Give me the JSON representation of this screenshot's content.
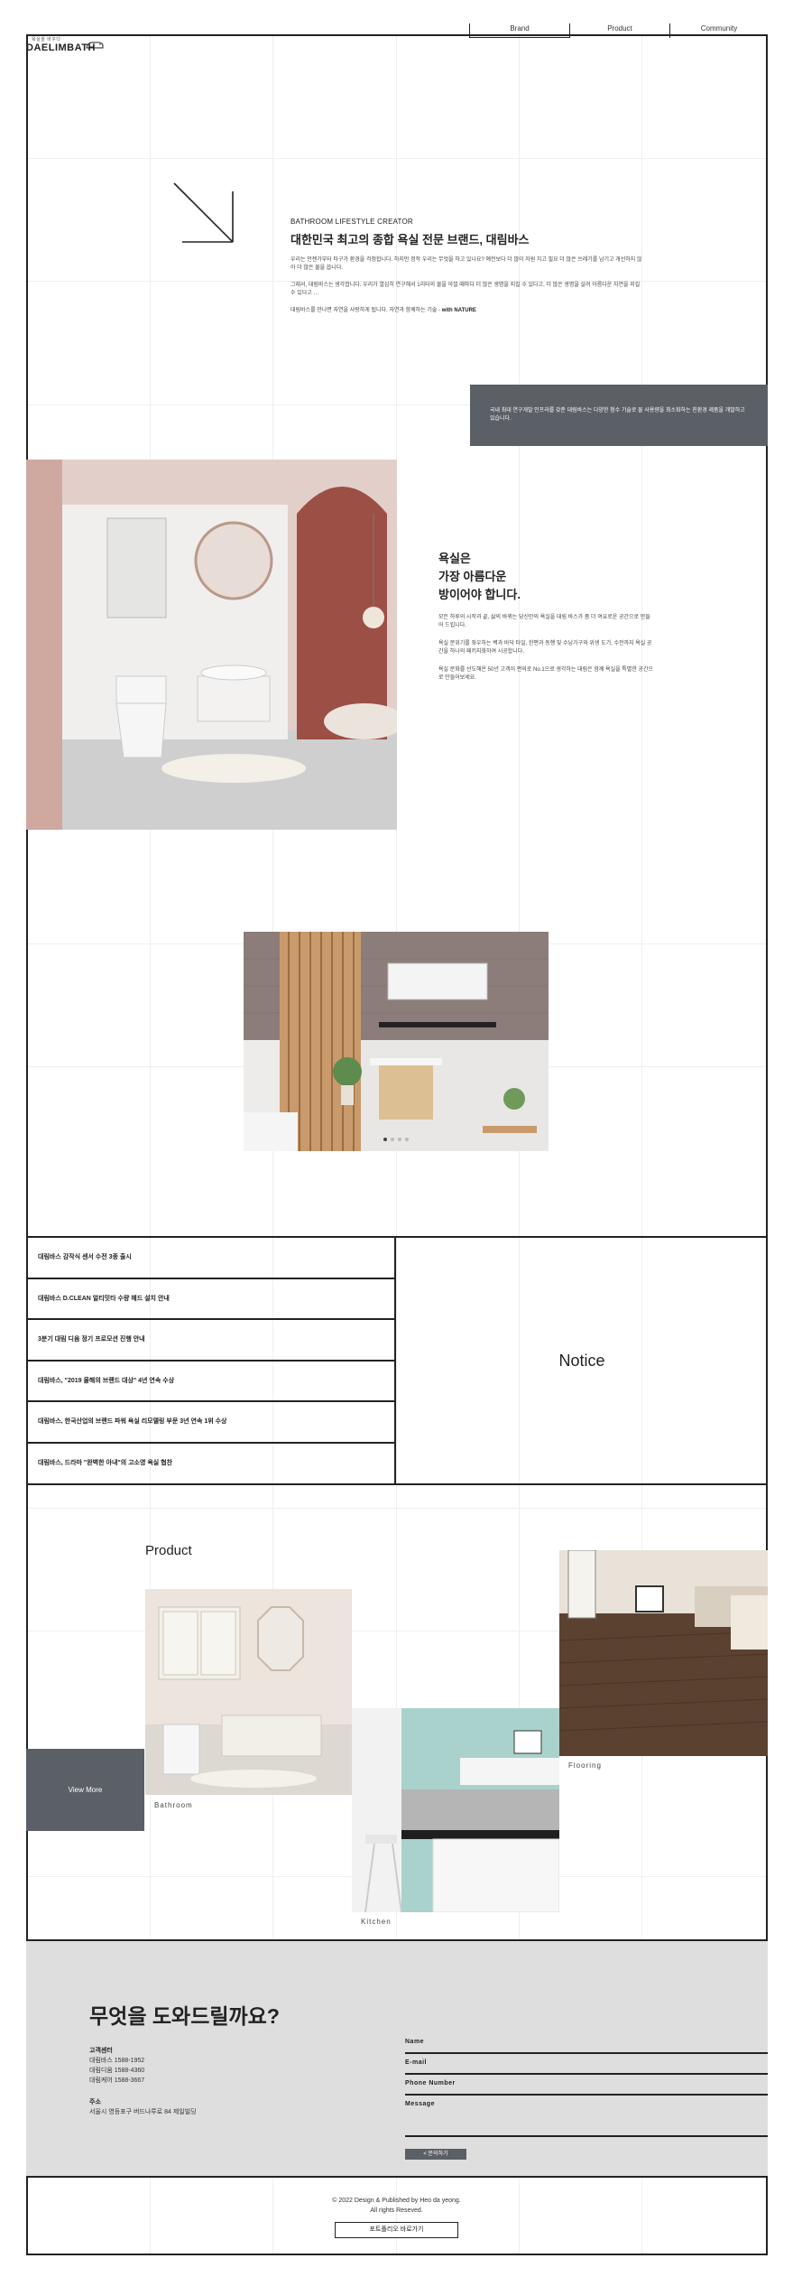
{
  "header": {
    "logo_small": "욕실을 바꾸다",
    "logo_big": "DAELIMBATH",
    "nav": [
      "Brand",
      "Product",
      "Community"
    ]
  },
  "intro": {
    "eyebrow": "BATHROOM LIFESTYLE CREATOR",
    "title": "대한민국 최고의 종합 욕실 전문 브랜드, 대림바스",
    "p1": "우리는 언젠가부터 타구가 환경을 걱정합니다. 하지만 정작 우리는 무엇을 하고 있나요? 예전보다 더 많이 자원 치고 필요 더 많은 쓰레기를 남기고 개선하지 않아 더 많은 물을 씁니다.",
    "p2": "그래서, 대림바스는 생각합니다. 우리가 열심히 연구해서 1리터의 물을 아낄 때마다 더 많은 생명을 지킬 수 있다고, 더 많은 생명을 살려 아름다운 자연을 지킬 수 있다고 …",
    "p3_text": "대림바스를 만나면 자연을 사랑하게 됩니다. 자연과 함께하는 기술 - ",
    "p3_bold": "with NATURE"
  },
  "gray_box": "국내 최대 연구개발 인프라를 갖춘 대림바스는 다양한 첨수 기술로 물 사용량을 최소화하는 친환경 제품을 개발하고 있습니다.",
  "quote": {
    "line1": "욕실은",
    "line2": "가장 아름다운",
    "line3": "방이어야 합니다.",
    "p1": "모든 하루의 시작과 끝, 삶의 바뀌는 당신만의 욕실을 대림 바스가 좀 더 여유로운 공간으로 만들어 드립니다.",
    "p2": "욕실 분위기를 좌우하는 벽과 바닥 타일, 한편과 동행 및 수납가구와 위생 도기, 수전까지 욕실 공간을 하나의 패키지화하여 시공합니다.",
    "p3": "욕실 문화를 선도해온 50년 고객이 편의로 No.1으로 생각하는 대림은 함께 욕실을 특별한 공간으로 만들어보세요."
  },
  "notices": [
    "대림바스 감작식 센서 수전 3종 출시",
    "대림바스 D.CLEAN 얼티밋타 수량 헤드 설치 안내",
    "3분기 대림 디움 정기 프로모션 진행 안내",
    "대림바스, \"2019 올해의 브랜드 대상\" 4년 연속 수상",
    "대림바스, 한국산업의 브랜드 파워 욕실 리모델링 부문 3년 연속 1위 수상",
    "대림바스, 드라마 \"완벽한 아내\"의 고소영 욕실 협찬"
  ],
  "notice_title": "Notice",
  "product": {
    "title": "Product",
    "view_more": "View More",
    "bathroom": "Bathroom",
    "kitchen": "Kitchen",
    "flooring": "Flooring"
  },
  "contact": {
    "heading": "무엇을 도와드릴까요?",
    "center_label": "고객센터",
    "center_lines": [
      "대림바스 1588-1952",
      "대림디움 1588-4360",
      "대림케어 1588-3667"
    ],
    "address_label": "주소",
    "address": "서울시 영등포구 버드나루로 84 제일빌딩",
    "fields": [
      "Name",
      "E-mail",
      "Phone Number",
      "Message"
    ],
    "submit": "< 문의하기"
  },
  "footer": {
    "line1": "© 2022 Design & Published by Heo da yeong.",
    "line2": "All rights Reseved.",
    "button": "포트폴리오 바로가기"
  },
  "colors": {
    "accent_gray": "#5b5f66",
    "contact_bg": "#dedede",
    "line": "#222222"
  }
}
